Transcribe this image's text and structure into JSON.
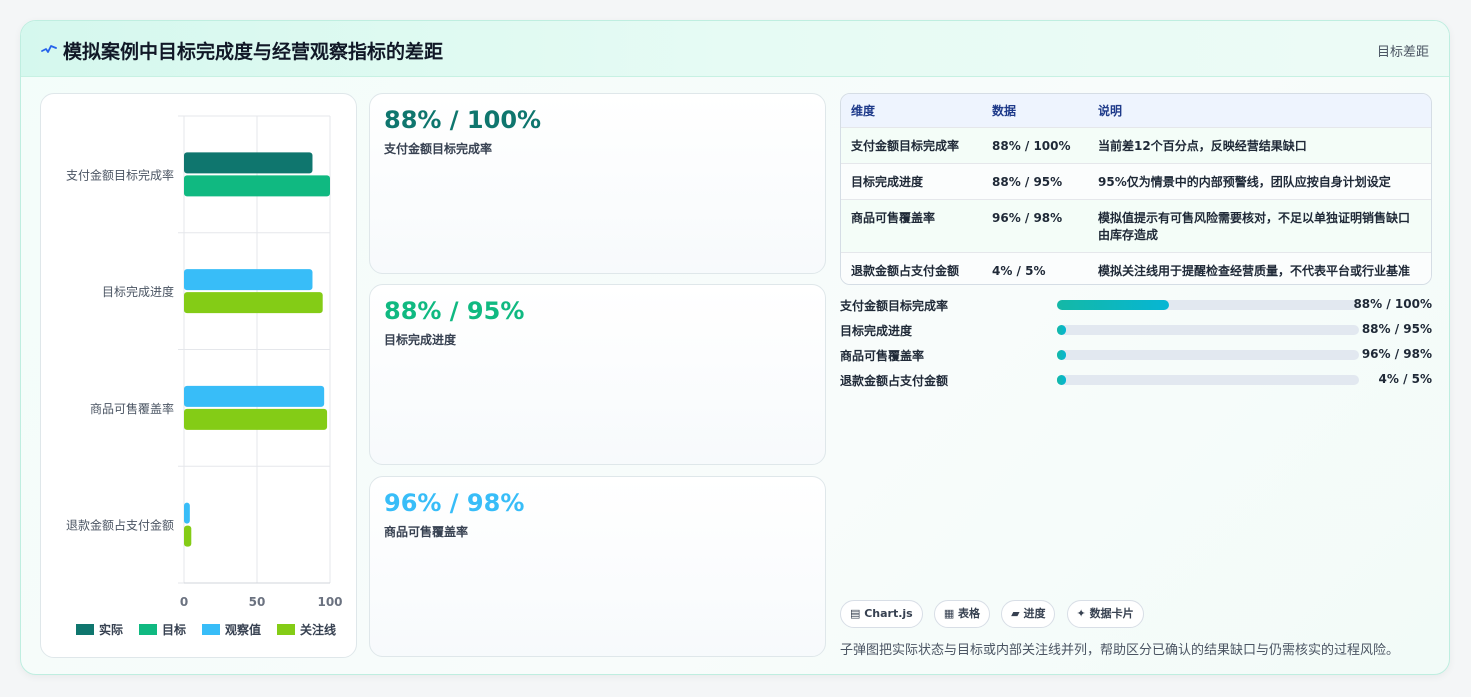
{
  "header": {
    "title": "模拟案例中目标完成度与经营观察指标的差距",
    "tag": "目标差距"
  },
  "chart_data": {
    "type": "bar",
    "categories": [
      "支付金额目标完成率",
      "目标完成进度",
      "商品可售覆盖率",
      "退款金额占支付金额"
    ],
    "series": [
      {
        "name": "实际",
        "color": "#0f766e",
        "values": [
          88,
          null,
          null,
          null
        ]
      },
      {
        "name": "目标",
        "color": "#10b981",
        "values": [
          100,
          null,
          null,
          null
        ]
      },
      {
        "name": "观察值",
        "color": "#38bdf8",
        "values": [
          null,
          88,
          96,
          4
        ]
      },
      {
        "name": "关注线",
        "color": "#84cc16",
        "values": [
          null,
          95,
          98,
          5
        ]
      }
    ],
    "xlim": [
      0,
      100
    ],
    "xticks": [
      "0",
      "50",
      "100"
    ],
    "orientation": "horizontal",
    "legend": "bottom"
  },
  "stats": [
    {
      "value": "88% / 100%",
      "label": "支付金额目标完成率",
      "color": "#0f766e"
    },
    {
      "value": "88% / 95%",
      "label": "目标完成进度",
      "color": "#10b981"
    },
    {
      "value": "96% / 98%",
      "label": "商品可售覆盖率",
      "color": "#38bdf8"
    }
  ],
  "table": {
    "headers": [
      "维度",
      "数据",
      "说明"
    ],
    "rows": [
      [
        "支付金额目标完成率",
        "88% / 100%",
        "当前差12个百分点，反映经营结果缺口"
      ],
      [
        "目标完成进度",
        "88% / 95%",
        "95%仅为情景中的内部预警线，团队应按自身计划设定"
      ],
      [
        "商品可售覆盖率",
        "96% / 98%",
        "模拟值提示有可售风险需要核对，不足以单独证明销售缺口由库存造成"
      ],
      [
        "退款金额占支付金额",
        "4% / 5%",
        "模拟关注线用于提醒检查经营质量，不代表平台或行业基准"
      ]
    ]
  },
  "progress": [
    {
      "label": "支付金额目标完成率",
      "value": "88% / 100%",
      "fraction": 0.37
    },
    {
      "label": "目标完成进度",
      "value": "88% / 95%",
      "fraction": 0.03
    },
    {
      "label": "商品可售覆盖率",
      "value": "96% / 98%",
      "fraction": 0.03
    },
    {
      "label": "退款金额占支付金额",
      "value": "4% / 5%",
      "fraction": 0.03
    }
  ],
  "chips": [
    "▤ Chart.js",
    "▦ 表格",
    "▰ 进度",
    "✦ 数据卡片"
  ],
  "footer_note": "子弹图把实际状态与目标或内部关注线并列，帮助区分已确认的结果缺口与仍需核实的过程风险。"
}
